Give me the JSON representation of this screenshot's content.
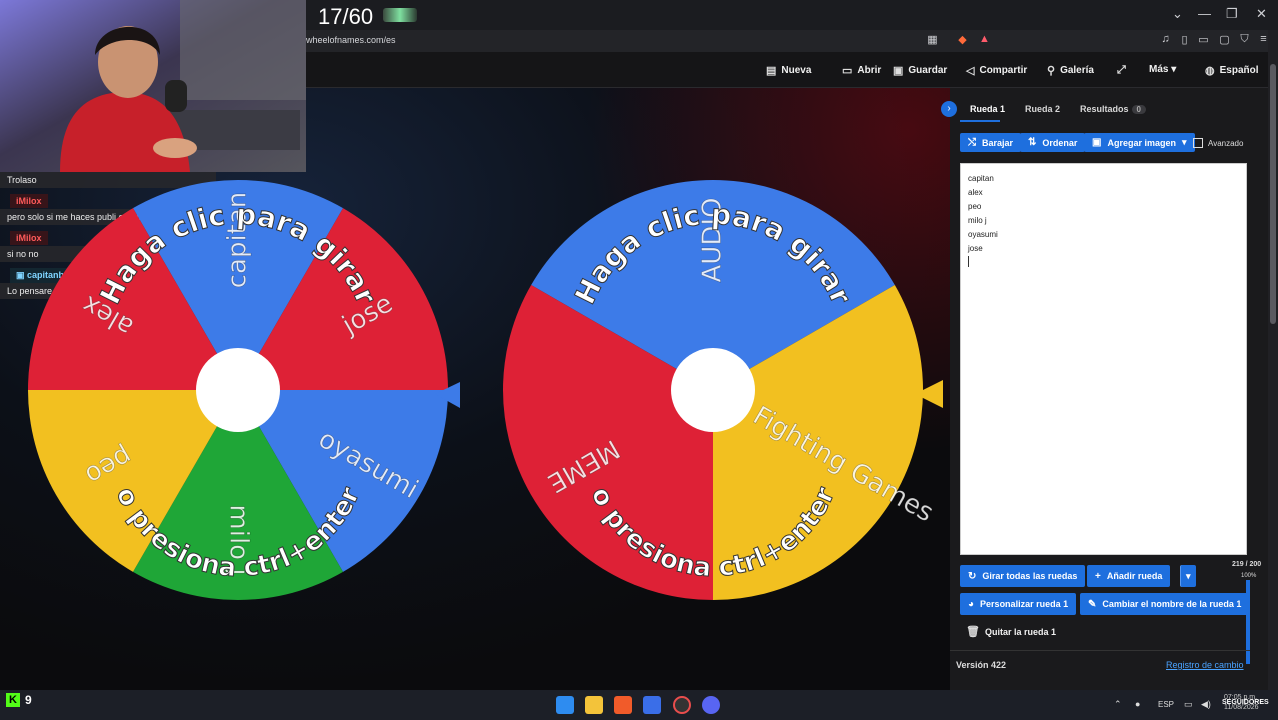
{
  "stream": {
    "counter": "17/60",
    "kick_count": "9"
  },
  "browser": {
    "url": "wheelofnames.com/es",
    "window_controls": [
      "⌄",
      "—",
      "❐",
      "✕"
    ]
  },
  "header": {
    "nav": [
      {
        "icon": "file-icon",
        "glyph": "▤",
        "label": "Nueva"
      },
      {
        "icon": "folder-open-icon",
        "glyph": "▭",
        "label": "Abrir"
      },
      {
        "icon": "save-icon",
        "glyph": "▣",
        "label": "Guardar"
      },
      {
        "icon": "share-icon",
        "glyph": "◁",
        "label": "Compartir"
      },
      {
        "icon": "search-icon",
        "glyph": "⚲",
        "label": "Galería"
      },
      {
        "icon": "fullscreen-icon",
        "glyph": "⤢",
        "label": ""
      },
      {
        "icon": "more-icon",
        "glyph": "",
        "label": "Más ▾"
      },
      {
        "icon": "globe-icon",
        "glyph": "◍",
        "label": "Español"
      }
    ]
  },
  "chat": {
    "messages": [
      {
        "user": "",
        "text": "Trolaso"
      },
      {
        "user": "iMilox",
        "text": "pero solo si me haces publi en mi marca"
      },
      {
        "user": "iMilox",
        "text": "si no no"
      },
      {
        "user": "capitanbalatro",
        "text": "Lo pensare"
      }
    ]
  },
  "wheel1": {
    "prompt_top": "Haga clic para girar",
    "prompt_bottom": "o presiona ctrl+enter",
    "segments": [
      {
        "label": "capitan",
        "color": "#3d7be8"
      },
      {
        "label": "jose",
        "color": "#de2136"
      },
      {
        "label": "oyasumi",
        "color": "#3d7be8"
      },
      {
        "label": "milo j",
        "color": "#1fa637"
      },
      {
        "label": "peo",
        "color": "#f2c020"
      },
      {
        "label": "alex",
        "color": "#de2136"
      }
    ]
  },
  "wheel2": {
    "prompt_top": "Haga clic para girar",
    "prompt_bottom": "o presiona ctrl+enter",
    "segments": [
      {
        "label": "AUDIO",
        "color": "#3d7be8"
      },
      {
        "label": "Fighting Games",
        "color": "#f2c020"
      },
      {
        "label": "MEME",
        "color": "#de2136"
      }
    ]
  },
  "panel": {
    "tabs": [
      "Rueda 1",
      "Rueda 2",
      "Resultados"
    ],
    "results_count": "0",
    "tools": [
      "Barajar",
      "Ordenar",
      "Agregar imagen"
    ],
    "advanced_label": "Avanzado",
    "entries": [
      "capitan",
      "alex",
      "peo",
      "milo j",
      "oyasumi",
      "jose"
    ],
    "char_count": "219 / 200",
    "percent": "100%",
    "spin_all_label": "Girar todas las ruedas",
    "add_wheel_label": "Añadir rueda",
    "customize_label": "Personalizar rueda 1",
    "rename_label": "Cambiar el nombre de la rueda 1",
    "remove_label": "Quitar la rueda 1",
    "version": "Versión 422",
    "changelog": "Registro de cambio"
  },
  "taskbar": {
    "lang": "ESP",
    "time": "07:05 p.m.",
    "date": "11/08/2026",
    "tray_text": "SEGUIDORES"
  }
}
